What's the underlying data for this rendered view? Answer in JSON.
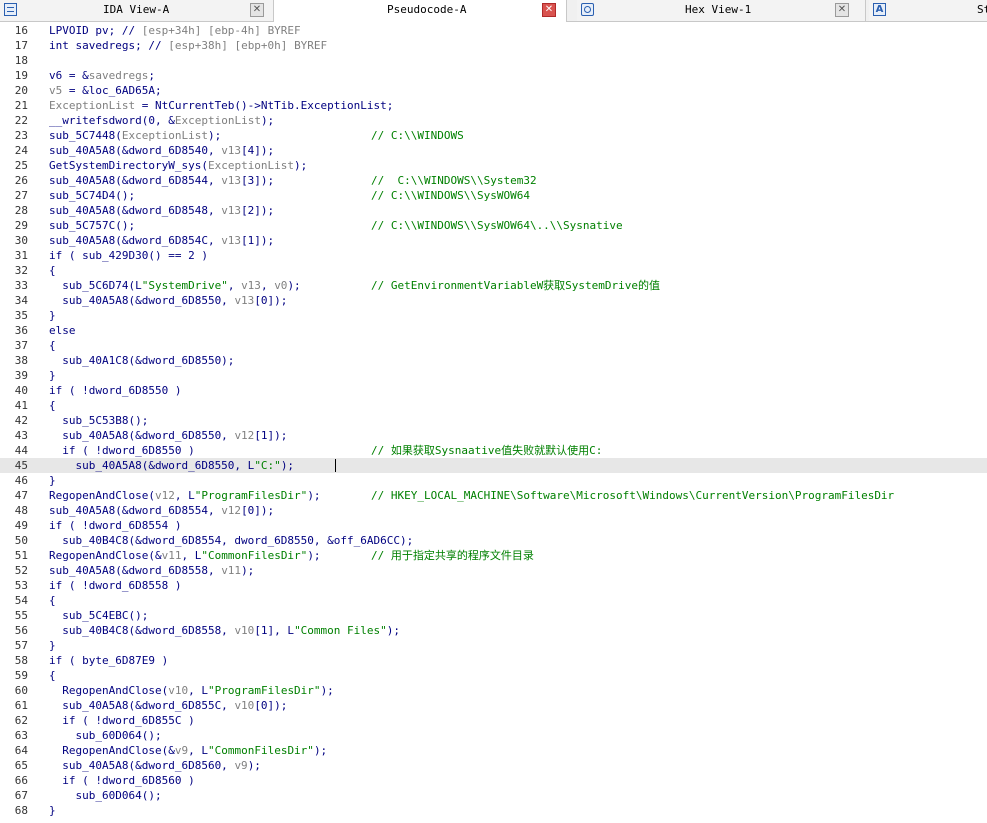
{
  "tabs": [
    {
      "label": "IDA View-A",
      "icon": "ida-view-icon",
      "active": false
    },
    {
      "label": "Pseudocode-A",
      "icon": "pseudocode-icon",
      "active": true
    },
    {
      "label": "Hex View-1",
      "icon": "hex-view-icon",
      "active": false
    },
    {
      "label": "St",
      "icon": "strings-icon",
      "icon_glyph": "A",
      "active": false
    }
  ],
  "lines": [
    {
      "n": "16",
      "code": [
        [
          "n",
          "LPVOID pv; // "
        ],
        [
          "v",
          "[esp+34h] [ebp-4h]"
        ],
        [
          "n",
          " "
        ],
        [
          "v",
          "BYREF"
        ]
      ]
    },
    {
      "n": "17",
      "code": [
        [
          "n",
          "int savedregs; // "
        ],
        [
          "v",
          "[esp+38h] [ebp+0h]"
        ],
        [
          "n",
          " "
        ],
        [
          "v",
          "BYREF"
        ]
      ]
    },
    {
      "n": "18",
      "code": []
    },
    {
      "n": "19",
      "code": [
        [
          "n",
          "v6 = &"
        ],
        [
          "v",
          "savedregs"
        ],
        [
          "n",
          ";"
        ]
      ]
    },
    {
      "n": "20",
      "code": [
        [
          "v",
          "v5"
        ],
        [
          "n",
          " = &loc_6AD65A;"
        ]
      ]
    },
    {
      "n": "21",
      "code": [
        [
          "v",
          "ExceptionList"
        ],
        [
          "n",
          " = NtCurrentTeb()->NtTib.ExceptionList;"
        ]
      ]
    },
    {
      "n": "22",
      "code": [
        [
          "n",
          "__writefsdword(0, &"
        ],
        [
          "v",
          "ExceptionList"
        ],
        [
          "n",
          ");"
        ]
      ]
    },
    {
      "n": "23",
      "code": [
        [
          "n",
          "sub_5C7448("
        ],
        [
          "v",
          "ExceptionList"
        ],
        [
          "n",
          ");"
        ]
      ],
      "comment": "// C:\\\\WINDOWS"
    },
    {
      "n": "24",
      "code": [
        [
          "n",
          "sub_40A5A8(&dword_6D8540, "
        ],
        [
          "v",
          "v13"
        ],
        [
          "n",
          "[4]);"
        ]
      ]
    },
    {
      "n": "25",
      "code": [
        [
          "n",
          "GetSystemDirectoryW_sys("
        ],
        [
          "v",
          "ExceptionList"
        ],
        [
          "n",
          ");"
        ]
      ]
    },
    {
      "n": "26",
      "code": [
        [
          "n",
          "sub_40A5A8(&dword_6D8544, "
        ],
        [
          "v",
          "v13"
        ],
        [
          "n",
          "[3]);"
        ]
      ],
      "comment": "//  C:\\\\WINDOWS\\\\System32"
    },
    {
      "n": "27",
      "code": [
        [
          "n",
          "sub_5C74D4();"
        ]
      ],
      "comment": "// C:\\\\WINDOWS\\\\SysWOW64"
    },
    {
      "n": "28",
      "code": [
        [
          "n",
          "sub_40A5A8(&dword_6D8548, "
        ],
        [
          "v",
          "v13"
        ],
        [
          "n",
          "[2]);"
        ]
      ]
    },
    {
      "n": "29",
      "code": [
        [
          "n",
          "sub_5C757C();"
        ]
      ],
      "comment": "// C:\\\\WINDOWS\\\\SysWOW64\\..\\\\Sysnative"
    },
    {
      "n": "30",
      "code": [
        [
          "n",
          "sub_40A5A8(&dword_6D854C, "
        ],
        [
          "v",
          "v13"
        ],
        [
          "n",
          "[1]);"
        ]
      ]
    },
    {
      "n": "31",
      "code": [
        [
          "n",
          "if ( sub_429D30() == 2 )"
        ]
      ]
    },
    {
      "n": "32",
      "code": [
        [
          "n",
          "{"
        ]
      ]
    },
    {
      "n": "33",
      "code": [
        [
          "n",
          "  sub_5C6D74(L"
        ],
        [
          "s",
          "\"SystemDrive\""
        ],
        [
          "n",
          ", "
        ],
        [
          "v",
          "v13"
        ],
        [
          "n",
          ", "
        ],
        [
          "v",
          "v0"
        ],
        [
          "n",
          ");"
        ]
      ],
      "comment": "// GetEnvironmentVariableW获取SystemDrive的值"
    },
    {
      "n": "34",
      "code": [
        [
          "n",
          "  sub_40A5A8(&dword_6D8550, "
        ],
        [
          "v",
          "v13"
        ],
        [
          "n",
          "[0]);"
        ]
      ]
    },
    {
      "n": "35",
      "code": [
        [
          "n",
          "}"
        ]
      ]
    },
    {
      "n": "36",
      "code": [
        [
          "n",
          "else"
        ]
      ]
    },
    {
      "n": "37",
      "code": [
        [
          "n",
          "{"
        ]
      ]
    },
    {
      "n": "38",
      "code": [
        [
          "n",
          "  sub_40A1C8(&dword_6D8550);"
        ]
      ]
    },
    {
      "n": "39",
      "code": [
        [
          "n",
          "}"
        ]
      ]
    },
    {
      "n": "40",
      "code": [
        [
          "n",
          "if ( !dword_6D8550 )"
        ]
      ]
    },
    {
      "n": "41",
      "code": [
        [
          "n",
          "{"
        ]
      ]
    },
    {
      "n": "42",
      "code": [
        [
          "n",
          "  sub_5C53B8();"
        ]
      ]
    },
    {
      "n": "43",
      "code": [
        [
          "n",
          "  sub_40A5A8(&dword_6D8550, "
        ],
        [
          "v",
          "v12"
        ],
        [
          "n",
          "[1]);"
        ]
      ]
    },
    {
      "n": "44",
      "code": [
        [
          "n",
          "  if ( !dword_6D8550 )"
        ]
      ],
      "comment": "// 如果获取Sysnaative值失败就默认使用C:"
    },
    {
      "n": "45",
      "code": [
        [
          "n",
          "    sub_40A5A8(&dword_6D8550, L"
        ],
        [
          "s",
          "\"C:\""
        ],
        [
          "n",
          ");"
        ]
      ],
      "current": true
    },
    {
      "n": "46",
      "code": [
        [
          "n",
          "}"
        ]
      ]
    },
    {
      "n": "47",
      "code": [
        [
          "n",
          "RegopenAndClose("
        ],
        [
          "v",
          "v12"
        ],
        [
          "n",
          ", L"
        ],
        [
          "s",
          "\"ProgramFilesDir\""
        ],
        [
          "n",
          ");"
        ]
      ],
      "comment": "// HKEY_LOCAL_MACHINE\\Software\\Microsoft\\Windows\\CurrentVersion\\ProgramFilesDir"
    },
    {
      "n": "48",
      "code": [
        [
          "n",
          "sub_40A5A8(&dword_6D8554, "
        ],
        [
          "v",
          "v12"
        ],
        [
          "n",
          "[0]);"
        ]
      ]
    },
    {
      "n": "49",
      "code": [
        [
          "n",
          "if ( !dword_6D8554 )"
        ]
      ]
    },
    {
      "n": "50",
      "code": [
        [
          "n",
          "  sub_40B4C8(&dword_6D8554, dword_6D8550, &off_6AD6CC);"
        ]
      ]
    },
    {
      "n": "51",
      "code": [
        [
          "n",
          "RegopenAndClose(&"
        ],
        [
          "v",
          "v11"
        ],
        [
          "n",
          ", L"
        ],
        [
          "s",
          "\"CommonFilesDir\""
        ],
        [
          "n",
          ");"
        ]
      ],
      "comment": "// 用于指定共享的程序文件目录"
    },
    {
      "n": "52",
      "code": [
        [
          "n",
          "sub_40A5A8(&dword_6D8558, "
        ],
        [
          "v",
          "v11"
        ],
        [
          "n",
          ");"
        ]
      ]
    },
    {
      "n": "53",
      "code": [
        [
          "n",
          "if ( !dword_6D8558 )"
        ]
      ]
    },
    {
      "n": "54",
      "code": [
        [
          "n",
          "{"
        ]
      ]
    },
    {
      "n": "55",
      "code": [
        [
          "n",
          "  sub_5C4EBC();"
        ]
      ]
    },
    {
      "n": "56",
      "code": [
        [
          "n",
          "  sub_40B4C8(&dword_6D8558, "
        ],
        [
          "v",
          "v10"
        ],
        [
          "n",
          "[1], L"
        ],
        [
          "s",
          "\"Common Files\""
        ],
        [
          "n",
          ");"
        ]
      ]
    },
    {
      "n": "57",
      "code": [
        [
          "n",
          "}"
        ]
      ]
    },
    {
      "n": "58",
      "code": [
        [
          "n",
          "if ( byte_6D87E9 )"
        ]
      ]
    },
    {
      "n": "59",
      "code": [
        [
          "n",
          "{"
        ]
      ]
    },
    {
      "n": "60",
      "code": [
        [
          "n",
          "  RegopenAndClose("
        ],
        [
          "v",
          "v10"
        ],
        [
          "n",
          ", L"
        ],
        [
          "s",
          "\"ProgramFilesDir\""
        ],
        [
          "n",
          ");"
        ]
      ]
    },
    {
      "n": "61",
      "code": [
        [
          "n",
          "  sub_40A5A8(&dword_6D855C, "
        ],
        [
          "v",
          "v10"
        ],
        [
          "n",
          "[0]);"
        ]
      ]
    },
    {
      "n": "62",
      "code": [
        [
          "n",
          "  if ( !dword_6D855C )"
        ]
      ]
    },
    {
      "n": "63",
      "code": [
        [
          "n",
          "    sub_60D064();"
        ]
      ]
    },
    {
      "n": "64",
      "code": [
        [
          "n",
          "  RegopenAndClose(&"
        ],
        [
          "v",
          "v9"
        ],
        [
          "n",
          ", L"
        ],
        [
          "s",
          "\"CommonFilesDir\""
        ],
        [
          "n",
          ");"
        ]
      ]
    },
    {
      "n": "65",
      "code": [
        [
          "n",
          "  sub_40A5A8(&dword_6D8560, "
        ],
        [
          "v",
          "v9"
        ],
        [
          "n",
          ");"
        ]
      ]
    },
    {
      "n": "66",
      "code": [
        [
          "n",
          "  if ( !dword_6D8560 )"
        ]
      ]
    },
    {
      "n": "67",
      "code": [
        [
          "n",
          "    sub_60D064();"
        ]
      ]
    },
    {
      "n": "68",
      "code": [
        [
          "n",
          "}"
        ]
      ]
    }
  ],
  "colors": {
    "keyword": "#000080",
    "variable": "#808080",
    "string": "#008000",
    "comment": "#008000",
    "current_line": "#e7e7e7"
  }
}
